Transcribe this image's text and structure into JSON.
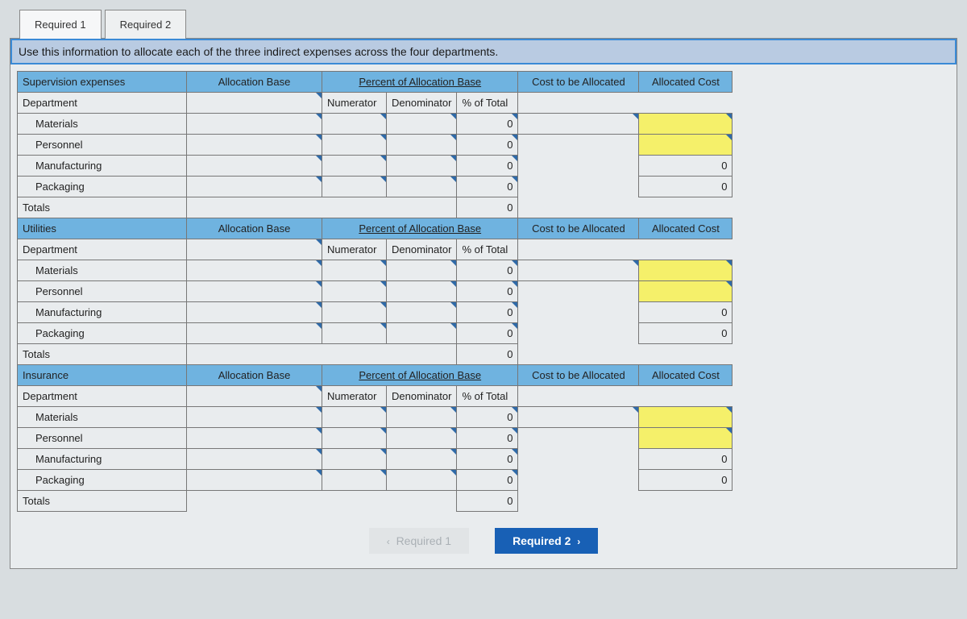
{
  "tabs": {
    "t1": "Required 1",
    "t2": "Required 2"
  },
  "instruction": "Use this information to allocate each of the three indirect expenses across the four departments.",
  "headers": {
    "alloc_base": "Allocation Base",
    "pct_base": "Percent of Allocation Base",
    "cost_alloc": "Cost to be Allocated",
    "alloc_cost": "Allocated Cost",
    "dept": "Department",
    "num": "Numerator",
    "den": "Denominator",
    "pct": "% of Total",
    "totals": "Totals"
  },
  "sections": {
    "s1": "Supervision expenses",
    "s2": "Utilities",
    "s3": "Insurance"
  },
  "depts": {
    "d1": "Materials",
    "d2": "Personnel",
    "d3": "Manufacturing",
    "d4": "Packaging"
  },
  "values": {
    "pct_zero": "0",
    "cost_zero": "0"
  },
  "nav": {
    "prev": "Required 1",
    "next": "Required 2"
  }
}
